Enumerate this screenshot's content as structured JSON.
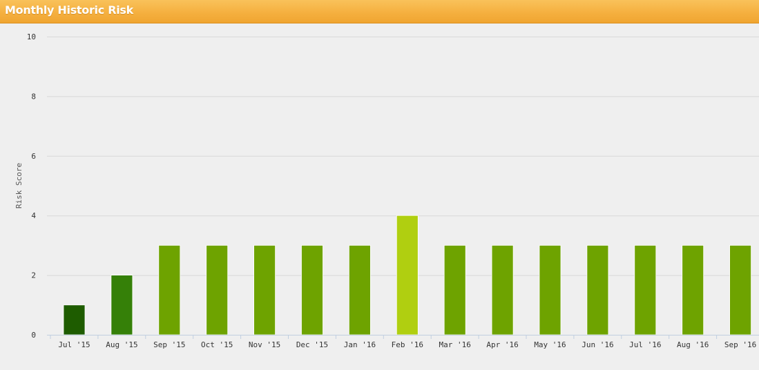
{
  "header": {
    "title": "Monthly Historic Risk"
  },
  "colors": {
    "header_bg": "#f5b040",
    "gridline": "#d8d8d8",
    "axis": "#c0cfe0"
  },
  "chart_data": {
    "type": "bar",
    "title": "Monthly Historic Risk",
    "xlabel": "",
    "ylabel": "Risk Score",
    "ylim": [
      0,
      10
    ],
    "yticks": [
      0,
      2,
      4,
      6,
      8,
      10
    ],
    "grid": true,
    "categories": [
      "Jul '15",
      "Aug '15",
      "Sep '15",
      "Oct '15",
      "Nov '15",
      "Dec '15",
      "Jan '16",
      "Feb '16",
      "Mar '16",
      "Apr '16",
      "May '16",
      "Jun '16",
      "Jul '16",
      "Aug '16",
      "Sep '16"
    ],
    "values": [
      1,
      2,
      3,
      3,
      3,
      3,
      3,
      4,
      3,
      3,
      3,
      3,
      3,
      3,
      3
    ],
    "bar_colors": [
      "#1e5c00",
      "#358008",
      "#6ea300",
      "#6ea300",
      "#6ea300",
      "#6ea300",
      "#6ea300",
      "#b0cf10",
      "#6ea300",
      "#6ea300",
      "#6ea300",
      "#6ea300",
      "#6ea300",
      "#6ea300",
      "#6ea300"
    ]
  }
}
